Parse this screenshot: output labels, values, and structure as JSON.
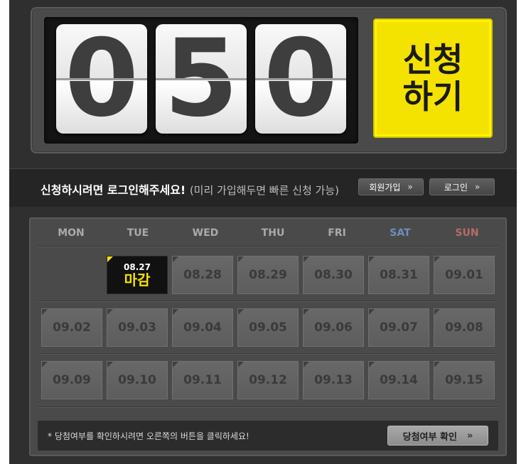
{
  "counter": {
    "digits": [
      "0",
      "5",
      "0"
    ],
    "apply_label": "신청\n하기"
  },
  "login_bar": {
    "message": "신청하시려면 로그인해주세요!",
    "sub_message": "(미리 가입해두면 빠른 신청 가능)",
    "join_label": "회원가입",
    "login_label": "로그인",
    "chevron": "»"
  },
  "calendar": {
    "weekdays": [
      "MON",
      "TUE",
      "WED",
      "THU",
      "FRI",
      "SAT",
      "SUN"
    ],
    "closed_day": {
      "date": "08.27",
      "status": "마감"
    },
    "row1": [
      "08.28",
      "08.29",
      "08.30",
      "08.31",
      "09.01"
    ],
    "row2": [
      "09.02",
      "09.03",
      "09.04",
      "09.05",
      "09.06",
      "09.07",
      "09.08"
    ],
    "row3": [
      "09.09",
      "09.10",
      "09.11",
      "09.12",
      "09.13",
      "09.14",
      "09.15"
    ],
    "colors": {
      "sat": "#6b8fbd",
      "sun": "#b86a6a",
      "accent": "#f4e200"
    }
  },
  "footer": {
    "note": "* 당첨여부를 확인하시려면 오른쪽의 버튼을 클릭하세요!",
    "check_label": "당첨여부 확인",
    "chevron": "»"
  }
}
